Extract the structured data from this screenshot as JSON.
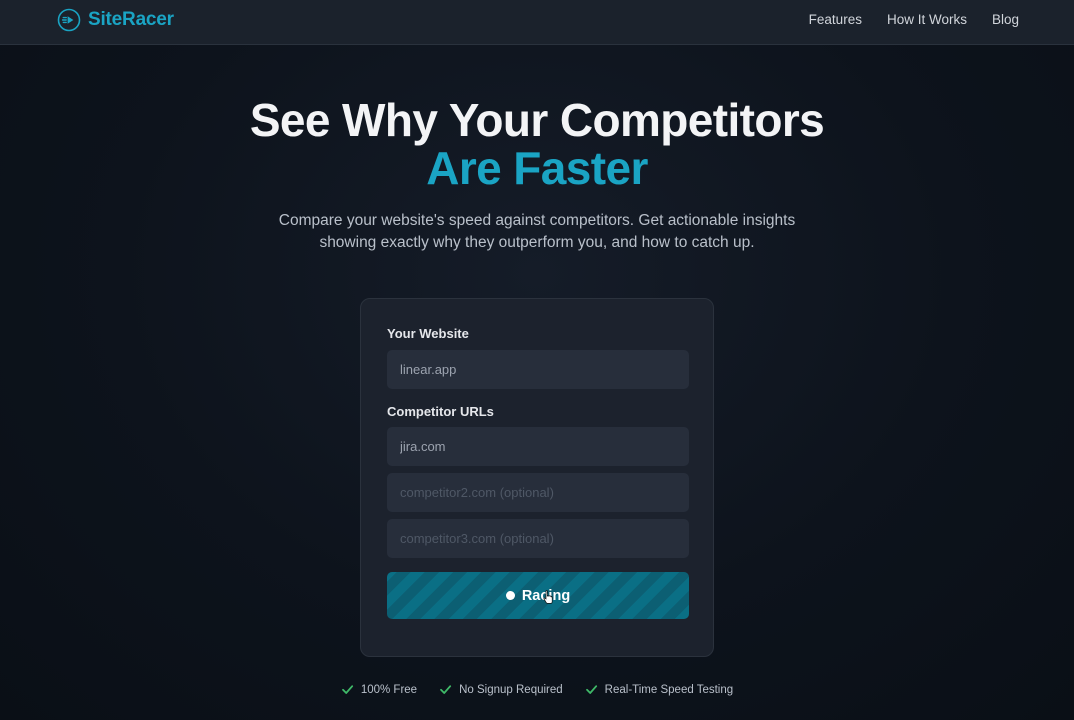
{
  "brand": {
    "name": "SiteRacer",
    "accent_color": "#1aa4c4",
    "icon": "play-speed-icon"
  },
  "nav": {
    "items": [
      "Features",
      "How It Works",
      "Blog"
    ]
  },
  "hero": {
    "title_line1": "See Why Your Competitors",
    "title_line2": "Are Faster",
    "subtitle_line1": "Compare your website's speed against competitors. Get actionable insights",
    "subtitle_line2": "showing exactly why they outperform you, and how to catch up."
  },
  "form": {
    "your_website_label": "Your Website",
    "your_website_value": "linear.app",
    "competitors_label": "Competitor URLs",
    "competitor1_value": "jira.com",
    "competitor2_placeholder": "competitor2.com (optional)",
    "competitor3_placeholder": "competitor3.com (optional)",
    "submit_label": "Racing"
  },
  "features": [
    "100% Free",
    "No Signup Required",
    "Real-Time Speed Testing"
  ],
  "colors": {
    "check": "#3fb968",
    "button_stripe_a": "#0a6f85",
    "button_stripe_b": "#0c5f73"
  }
}
